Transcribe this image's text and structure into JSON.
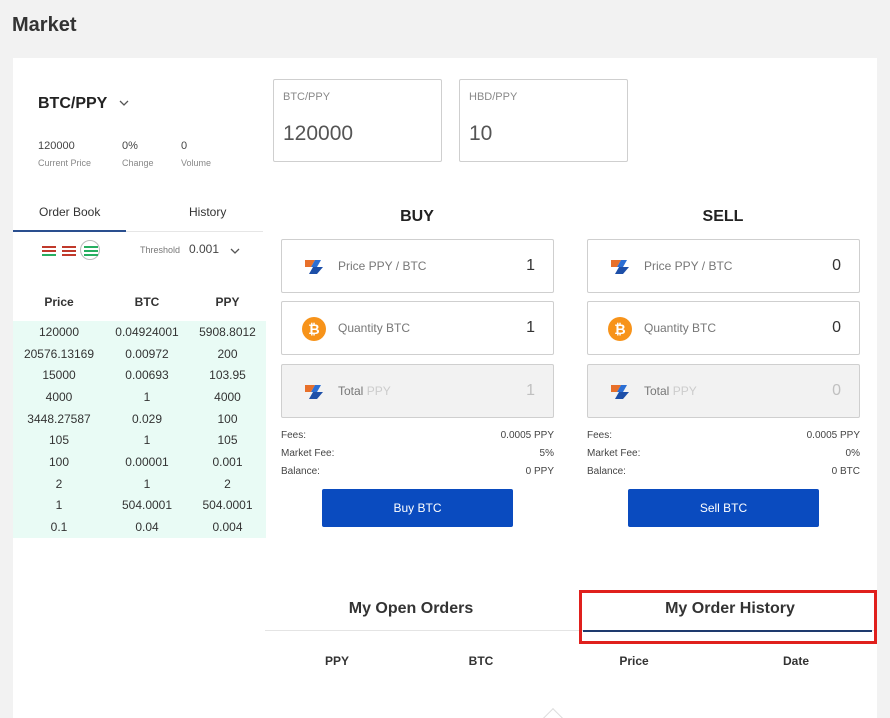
{
  "page": {
    "title": "Market"
  },
  "pair": {
    "name": "BTC/PPY",
    "stats": [
      {
        "value": "120000",
        "label": "Current Price"
      },
      {
        "value": "0%",
        "label": "Change"
      },
      {
        "value": "0",
        "label": "Volume"
      }
    ]
  },
  "left_tabs": {
    "order_book": "Order Book",
    "history": "History"
  },
  "threshold": {
    "label": "Threshold",
    "value": "0.001"
  },
  "order_book": {
    "headers": [
      "Price",
      "BTC",
      "PPY"
    ],
    "rows": [
      [
        "120000",
        "0.04924001",
        "5908.8012"
      ],
      [
        "20576.13169",
        "0.00972",
        "200"
      ],
      [
        "15000",
        "0.00693",
        "103.95"
      ],
      [
        "4000",
        "1",
        "4000"
      ],
      [
        "3448.27587",
        "0.029",
        "100"
      ],
      [
        "105",
        "1",
        "105"
      ],
      [
        "100",
        "0.00001",
        "0.001"
      ],
      [
        "2",
        "1",
        "2"
      ],
      [
        "1",
        "504.0001",
        "504.0001"
      ],
      [
        "0.1",
        "0.04",
        "0.004"
      ]
    ]
  },
  "price_boxes": [
    {
      "label": "BTC/PPY",
      "value": "120000"
    },
    {
      "label": "HBD/PPY",
      "value": "10"
    }
  ],
  "buy": {
    "title": "BUY",
    "price_label": "Price PPY / BTC",
    "price_value": "1",
    "qty_label": "Quantity BTC",
    "qty_value": "1",
    "total_label": "Total",
    "total_unit": "PPY",
    "total_value": "1",
    "fees_label": "Fees:",
    "fees_value": "0.0005 PPY",
    "market_fee_label": "Market Fee:",
    "market_fee_value": "5%",
    "balance_label": "Balance:",
    "balance_value": "0 PPY",
    "button": "Buy BTC"
  },
  "sell": {
    "title": "SELL",
    "price_label": "Price PPY / BTC",
    "price_value": "0",
    "qty_label": "Quantity BTC",
    "qty_value": "0",
    "total_label": "Total",
    "total_unit": "PPY",
    "total_value": "0",
    "fees_label": "Fees:",
    "fees_value": "0.0005 PPY",
    "market_fee_label": "Market Fee:",
    "market_fee_value": "0%",
    "balance_label": "Balance:",
    "balance_value": "0 BTC",
    "button": "Sell BTC"
  },
  "orders": {
    "tab_open": "My Open Orders",
    "tab_history": "My Order History",
    "columns": [
      "PPY",
      "BTC",
      "Price",
      "Date"
    ]
  },
  "colors": {
    "accent": "#0a4bbf",
    "highlight": "#e0201d",
    "book_bg": "#e9fbf5"
  },
  "icons": {
    "ppy": "ppy-logo-icon",
    "btc": "bitcoin-icon",
    "chevron": "chevron-down-icon"
  }
}
